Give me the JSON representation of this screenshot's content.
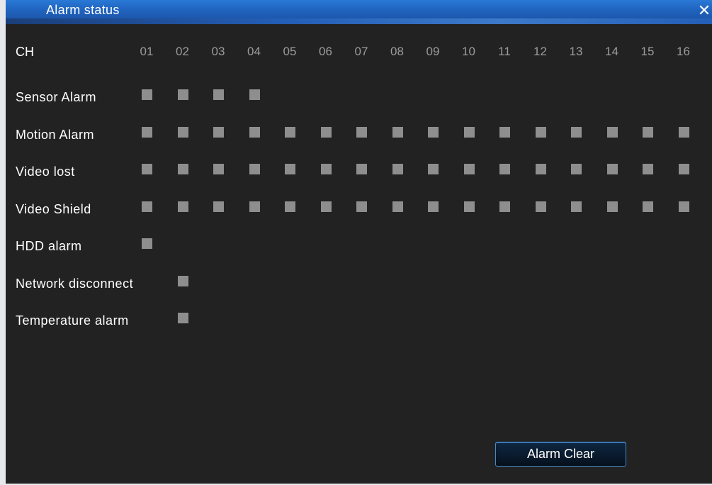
{
  "window": {
    "title": "Alarm status",
    "close_icon": "close-icon",
    "close_glyph": "✕"
  },
  "table": {
    "ch_label": "CH",
    "channels": [
      "01",
      "02",
      "03",
      "04",
      "05",
      "06",
      "07",
      "08",
      "09",
      "10",
      "11",
      "12",
      "13",
      "14",
      "15",
      "16"
    ],
    "indicator_color": "#8e8e8e",
    "rows": [
      {
        "label": "Sensor Alarm",
        "active_channels": [
          "01",
          "02",
          "03",
          "04"
        ]
      },
      {
        "label": "Motion Alarm",
        "active_channels": [
          "01",
          "02",
          "03",
          "04",
          "05",
          "06",
          "07",
          "08",
          "09",
          "10",
          "11",
          "12",
          "13",
          "14",
          "15",
          "16"
        ]
      },
      {
        "label": "Video lost",
        "active_channels": [
          "01",
          "02",
          "03",
          "04",
          "05",
          "06",
          "07",
          "08",
          "09",
          "10",
          "11",
          "12",
          "13",
          "14",
          "15",
          "16"
        ]
      },
      {
        "label": "Video Shield",
        "active_channels": [
          "01",
          "02",
          "03",
          "04",
          "05",
          "06",
          "07",
          "08",
          "09",
          "10",
          "11",
          "12",
          "13",
          "14",
          "15",
          "16"
        ]
      },
      {
        "label": "HDD alarm",
        "active_channels": [
          "01"
        ]
      },
      {
        "label": "Network disconnect",
        "active_channels": [
          "02"
        ]
      },
      {
        "label": "Temperature alarm",
        "active_channels": [
          "02"
        ]
      }
    ]
  },
  "buttons": {
    "alarm_clear": "Alarm Clear"
  },
  "colors": {
    "background": "#222222",
    "titlebar": "#1f62bd",
    "text": "#ffffff",
    "channel_number": "#9c9c9c",
    "button_border": "#4a89c9"
  }
}
